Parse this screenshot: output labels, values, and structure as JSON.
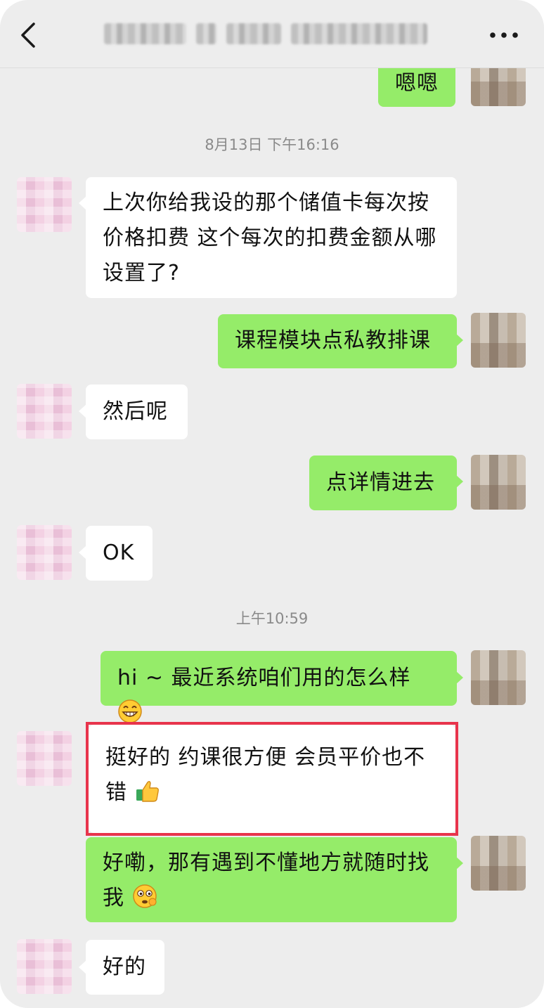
{
  "header": {
    "title": "",
    "back_icon": "chevron-left-icon",
    "more_icon": "more-horizontal-icon"
  },
  "colors": {
    "background": "#ededed",
    "my_bubble": "#95ec69",
    "other_bubble": "#ffffff",
    "highlight_border": "#e8344c",
    "timestamp_text": "#8a8a8a"
  },
  "timestamps": [
    "8月13日 下午16:16",
    "上午10:59"
  ],
  "messages": [
    {
      "sender": "me",
      "text": "嗯嗯"
    },
    {
      "sender": "other",
      "text": "上次你给我设的那个储值卡每次按价格扣费 这个每次的扣费金额从哪设置了?"
    },
    {
      "sender": "me",
      "text": "课程模块点私教排课"
    },
    {
      "sender": "other",
      "text": "然后呢"
    },
    {
      "sender": "me",
      "text": "点详情进去"
    },
    {
      "sender": "other",
      "text": "OK"
    },
    {
      "sender": "me",
      "text": "hi ~ 最近系统咱们用的怎么样",
      "emoji": "grinning-face-icon"
    },
    {
      "sender": "other",
      "text": "挺好的 约课很方便 会员平价也不错",
      "emoji": "thumbs-up-icon",
      "highlighted": true
    },
    {
      "sender": "me",
      "text": "好嘞，那有遇到不懂地方就随时找我",
      "emoji": "ok-hand-face-icon"
    },
    {
      "sender": "other",
      "text": "好的"
    }
  ]
}
